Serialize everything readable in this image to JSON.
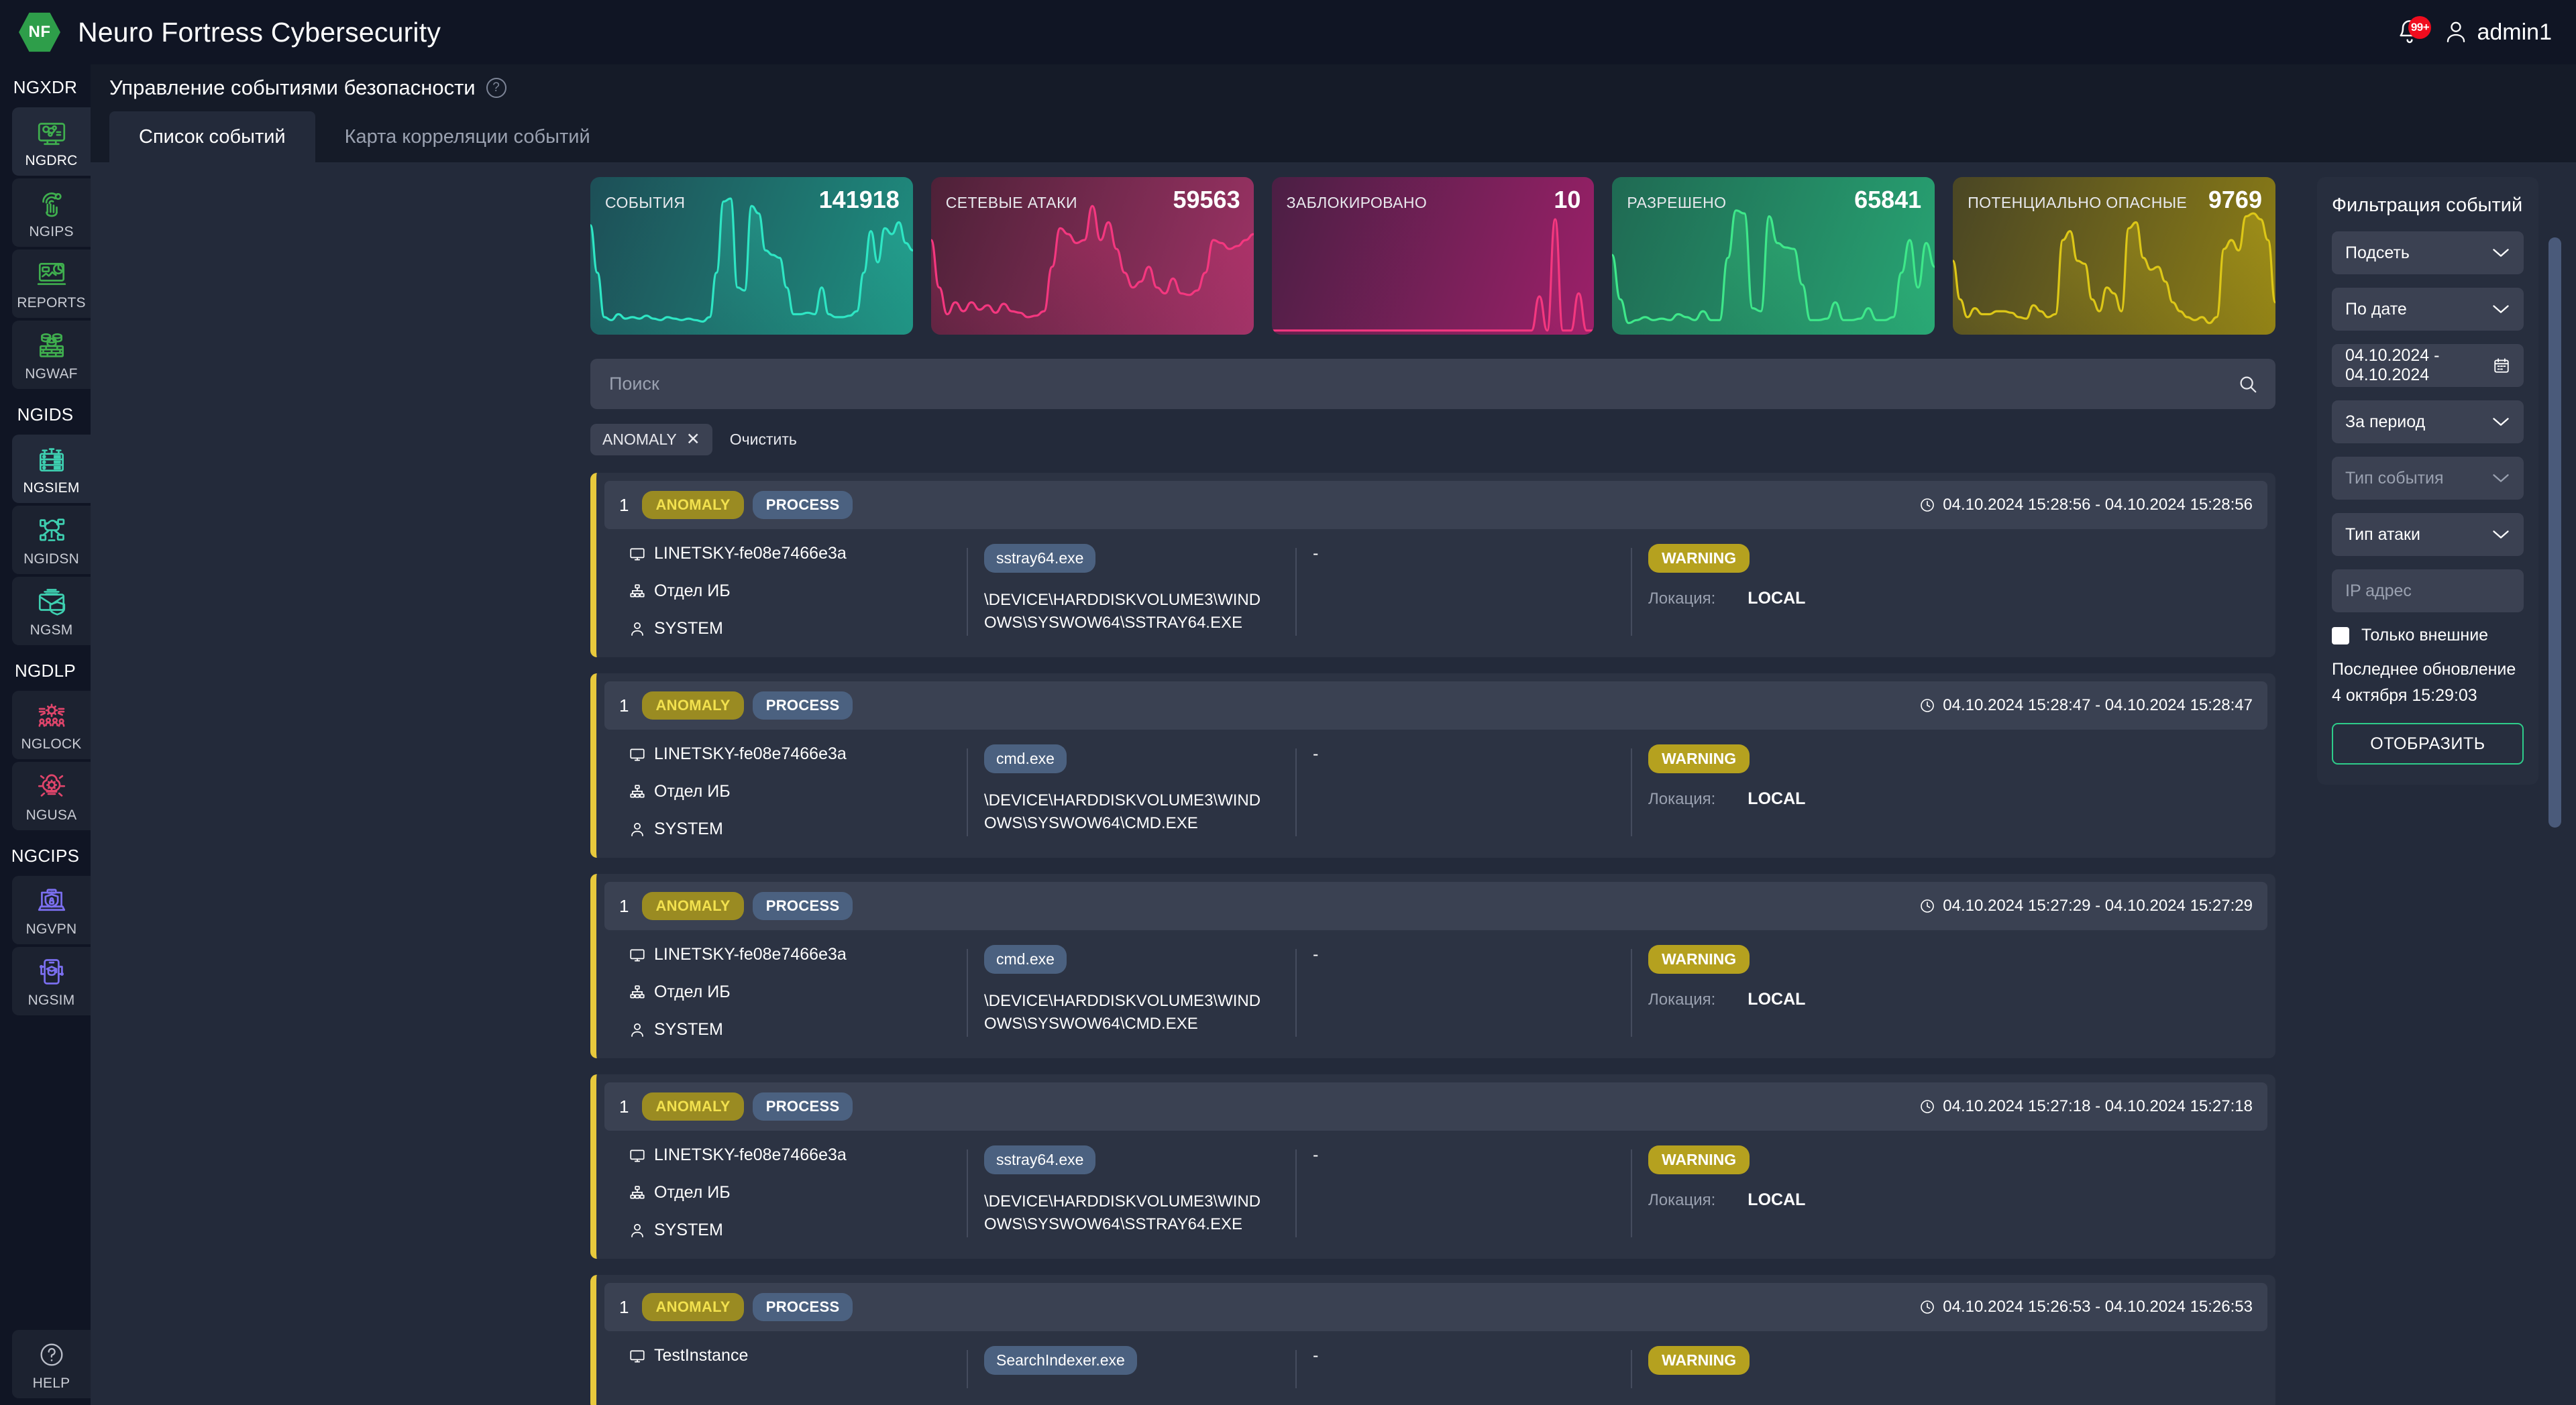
{
  "header": {
    "logo_text": "NF",
    "title": "Neuro Fortress Cybersecurity",
    "notification_badge": "99+",
    "user": "admin1",
    "bell_icon": "bell-icon",
    "user_icon": "user-icon"
  },
  "sidebar": {
    "groups": [
      {
        "label": "NGXDR",
        "items": [
          {
            "label": "NGDRC",
            "icon": "network-monitor-icon",
            "active": true,
            "color": "#3fae4e"
          },
          {
            "label": "NGIPS",
            "icon": "fingerprint-icon",
            "active": false,
            "color": "#3fae4e"
          },
          {
            "label": "REPORTS",
            "icon": "report-chart-icon",
            "active": false,
            "color": "#3fae4e"
          },
          {
            "label": "NGWAF",
            "icon": "firewall-brick-icon",
            "active": false,
            "color": "#3fae4e"
          }
        ]
      },
      {
        "label": "NGIDS",
        "items": [
          {
            "label": "NGSIEM",
            "icon": "server-rack-icon",
            "active": true,
            "color": "#3ecfb0"
          },
          {
            "label": "NGIDSN",
            "icon": "cloud-network-icon",
            "active": false,
            "color": "#3ecfb0"
          },
          {
            "label": "NGSM",
            "icon": "mail-shield-icon",
            "active": false,
            "color": "#3ecfb0"
          }
        ]
      },
      {
        "label": "NGDLP",
        "items": [
          {
            "label": "NGLOCK",
            "icon": "gear-users-icon",
            "active": false,
            "color": "#e0456b"
          },
          {
            "label": "NGUSA",
            "icon": "brain-gear-icon",
            "active": false,
            "color": "#e0456b"
          }
        ]
      },
      {
        "label": "NGCIPS",
        "items": [
          {
            "label": "NGVPN",
            "icon": "vpn-laptop-icon",
            "active": false,
            "color": "#7b6ff0"
          },
          {
            "label": "NGSIM",
            "icon": "mobile-training-icon",
            "active": false,
            "color": "#7b6ff0"
          }
        ]
      }
    ],
    "help": {
      "label": "HELP",
      "icon": "question-circle-icon"
    }
  },
  "page": {
    "title": "Управление событиями безопасности",
    "help_icon": "question-circle-icon",
    "tabs": [
      {
        "label": "Список событий",
        "active": true
      },
      {
        "label": "Карта корреляции событий",
        "active": false
      }
    ]
  },
  "search": {
    "placeholder": "Поиск",
    "value": "",
    "icon": "search-icon",
    "chips": [
      {
        "label": "ANOMALY",
        "remove_icon": "close-icon"
      }
    ],
    "clear_label": "Очистить"
  },
  "chart_data": [
    {
      "type": "area",
      "title": "СОБЫТИЯ",
      "value": 141918,
      "line_color": "#2ee6c4",
      "bg_from": "#1d4f57",
      "bg_to": "#1f8f80",
      "ylim": [
        0,
        100
      ],
      "values": [
        72,
        40,
        10,
        8,
        12,
        9,
        10,
        9,
        11,
        9,
        8,
        10,
        9,
        8,
        9,
        8,
        7,
        10,
        40,
        88,
        90,
        30,
        28,
        85,
        80,
        55,
        52,
        50,
        30,
        12,
        12,
        13,
        12,
        30,
        12,
        10,
        10,
        11,
        14,
        40,
        68,
        47,
        70,
        66,
        74,
        60,
        55
      ]
    },
    {
      "type": "area",
      "title": "СЕТЕВЫЕ АТАКИ",
      "value": 59563,
      "line_color": "#f4377f",
      "bg_from": "#4e2138",
      "bg_to": "#9e3366",
      "ylim": [
        0,
        100
      ],
      "values": [
        62,
        30,
        12,
        20,
        14,
        20,
        15,
        18,
        13,
        19,
        14,
        13,
        10,
        11,
        14,
        44,
        70,
        66,
        60,
        62,
        85,
        62,
        74,
        56,
        40,
        30,
        34,
        44,
        30,
        26,
        36,
        26,
        25,
        28,
        40,
        62,
        60,
        56,
        58,
        62,
        66
      ]
    },
    {
      "type": "area",
      "title": "ЗАБЛОКИРОВАНО",
      "value": 10,
      "line_color": "#f4377f",
      "bg_from": "#4b1f44",
      "bg_to": "#9c2069",
      "ylim": [
        0,
        100
      ],
      "values": [
        1,
        1,
        1,
        1,
        1,
        1,
        1,
        1,
        1,
        1,
        1,
        1,
        1,
        1,
        1,
        1,
        1,
        1,
        1,
        1,
        1,
        1,
        1,
        1,
        1,
        1,
        1,
        1,
        1,
        1,
        1,
        1,
        1,
        1,
        24,
        1,
        76,
        1,
        1,
        26,
        1,
        1
      ]
    },
    {
      "type": "area",
      "title": "РАЗРЕШЕНО",
      "value": 65841,
      "line_color": "#3ee88a",
      "bg_from": "#1f6a53",
      "bg_to": "#28a473",
      "ylim": [
        0,
        100
      ],
      "values": [
        52,
        22,
        6,
        8,
        10,
        8,
        9,
        8,
        12,
        10,
        8,
        14,
        8,
        8,
        50,
        82,
        80,
        16,
        14,
        78,
        60,
        57,
        56,
        32,
        8,
        8,
        9,
        20,
        8,
        8,
        9,
        16,
        8,
        8,
        10,
        40,
        62,
        30,
        60,
        44
      ]
    },
    {
      "type": "area",
      "title": "ПОТЕНЦИАЛЬНО ОПАСНЫЕ",
      "value": 9769,
      "line_color": "#ddc717",
      "bg_from": "#4a4624",
      "bg_to": "#8d7e16",
      "ylim": [
        0,
        100
      ],
      "values": [
        48,
        22,
        10,
        16,
        12,
        12,
        14,
        14,
        13,
        10,
        9,
        18,
        14,
        10,
        12,
        62,
        68,
        48,
        46,
        22,
        14,
        30,
        26,
        14,
        70,
        74,
        50,
        42,
        44,
        34,
        20,
        14,
        10,
        8,
        10,
        6,
        10,
        56,
        62,
        55,
        78,
        80,
        76,
        62,
        20
      ]
    }
  ],
  "cards": [
    {
      "label": "СОБЫТИЯ",
      "value": "141918"
    },
    {
      "label": "СЕТЕВЫЕ АТАКИ",
      "value": "59563"
    },
    {
      "label": "ЗАБЛОКИРОВАНО",
      "value": "10"
    },
    {
      "label": "РАЗРЕШЕНО",
      "value": "65841"
    },
    {
      "label": "ПОТЕНЦИАЛЬНО ОПАСНЫЕ",
      "value": "9769"
    }
  ],
  "events": [
    {
      "count": "1",
      "tag_anomaly": "ANOMALY",
      "tag_type": "PROCESS",
      "time": "04.10.2024 15:28:56 - 04.10.2024 15:28:56",
      "host": "LINETSKY-fe08e7466e3a",
      "dept": "Отдел ИБ",
      "user": "SYSTEM",
      "process": "sstray64.exe",
      "path": "\\DEVICE\\HARDDISKVOLUME3\\WINDOWS\\SYSWOW64\\SSTRAY64.EXE",
      "mid": "-",
      "status": "WARNING",
      "location_key": "Локация:",
      "location_value": "LOCAL"
    },
    {
      "count": "1",
      "tag_anomaly": "ANOMALY",
      "tag_type": "PROCESS",
      "time": "04.10.2024 15:28:47 - 04.10.2024 15:28:47",
      "host": "LINETSKY-fe08e7466e3a",
      "dept": "Отдел ИБ",
      "user": "SYSTEM",
      "process": "cmd.exe",
      "path": "\\DEVICE\\HARDDISKVOLUME3\\WINDOWS\\SYSWOW64\\CMD.EXE",
      "mid": "-",
      "status": "WARNING",
      "location_key": "Локация:",
      "location_value": "LOCAL"
    },
    {
      "count": "1",
      "tag_anomaly": "ANOMALY",
      "tag_type": "PROCESS",
      "time": "04.10.2024 15:27:29 - 04.10.2024 15:27:29",
      "host": "LINETSKY-fe08e7466e3a",
      "dept": "Отдел ИБ",
      "user": "SYSTEM",
      "process": "cmd.exe",
      "path": "\\DEVICE\\HARDDISKVOLUME3\\WINDOWS\\SYSWOW64\\CMD.EXE",
      "mid": "-",
      "status": "WARNING",
      "location_key": "Локация:",
      "location_value": "LOCAL"
    },
    {
      "count": "1",
      "tag_anomaly": "ANOMALY",
      "tag_type": "PROCESS",
      "time": "04.10.2024 15:27:18 - 04.10.2024 15:27:18",
      "host": "LINETSKY-fe08e7466e3a",
      "dept": "Отдел ИБ",
      "user": "SYSTEM",
      "process": "sstray64.exe",
      "path": "\\DEVICE\\HARDDISKVOLUME3\\WINDOWS\\SYSWOW64\\SSTRAY64.EXE",
      "mid": "-",
      "status": "WARNING",
      "location_key": "Локация:",
      "location_value": "LOCAL"
    },
    {
      "count": "1",
      "tag_anomaly": "ANOMALY",
      "tag_type": "PROCESS",
      "time": "04.10.2024 15:26:53 - 04.10.2024 15:26:53",
      "host": "TestInstance",
      "dept": "",
      "user": "",
      "process": "SearchIndexer.exe",
      "path": "",
      "mid": "-",
      "status": "WARNING",
      "location_key": "",
      "location_value": ""
    }
  ],
  "filters": {
    "title": "Фильтрация событий",
    "subnet": "Подсеть",
    "by_date": "По дате",
    "date_range": "04.10.2024 - 04.10.2024",
    "period": "За период",
    "event_type": "Тип события",
    "attack_type": "Тип атаки",
    "ip_placeholder": "IP адрес",
    "ip_value": "",
    "external_only": "Только внешние",
    "last_update_label": "Последнее обновление",
    "last_update_time": "4 октября 15:29:03",
    "show_button": "ОТОБРАЗИТЬ"
  }
}
